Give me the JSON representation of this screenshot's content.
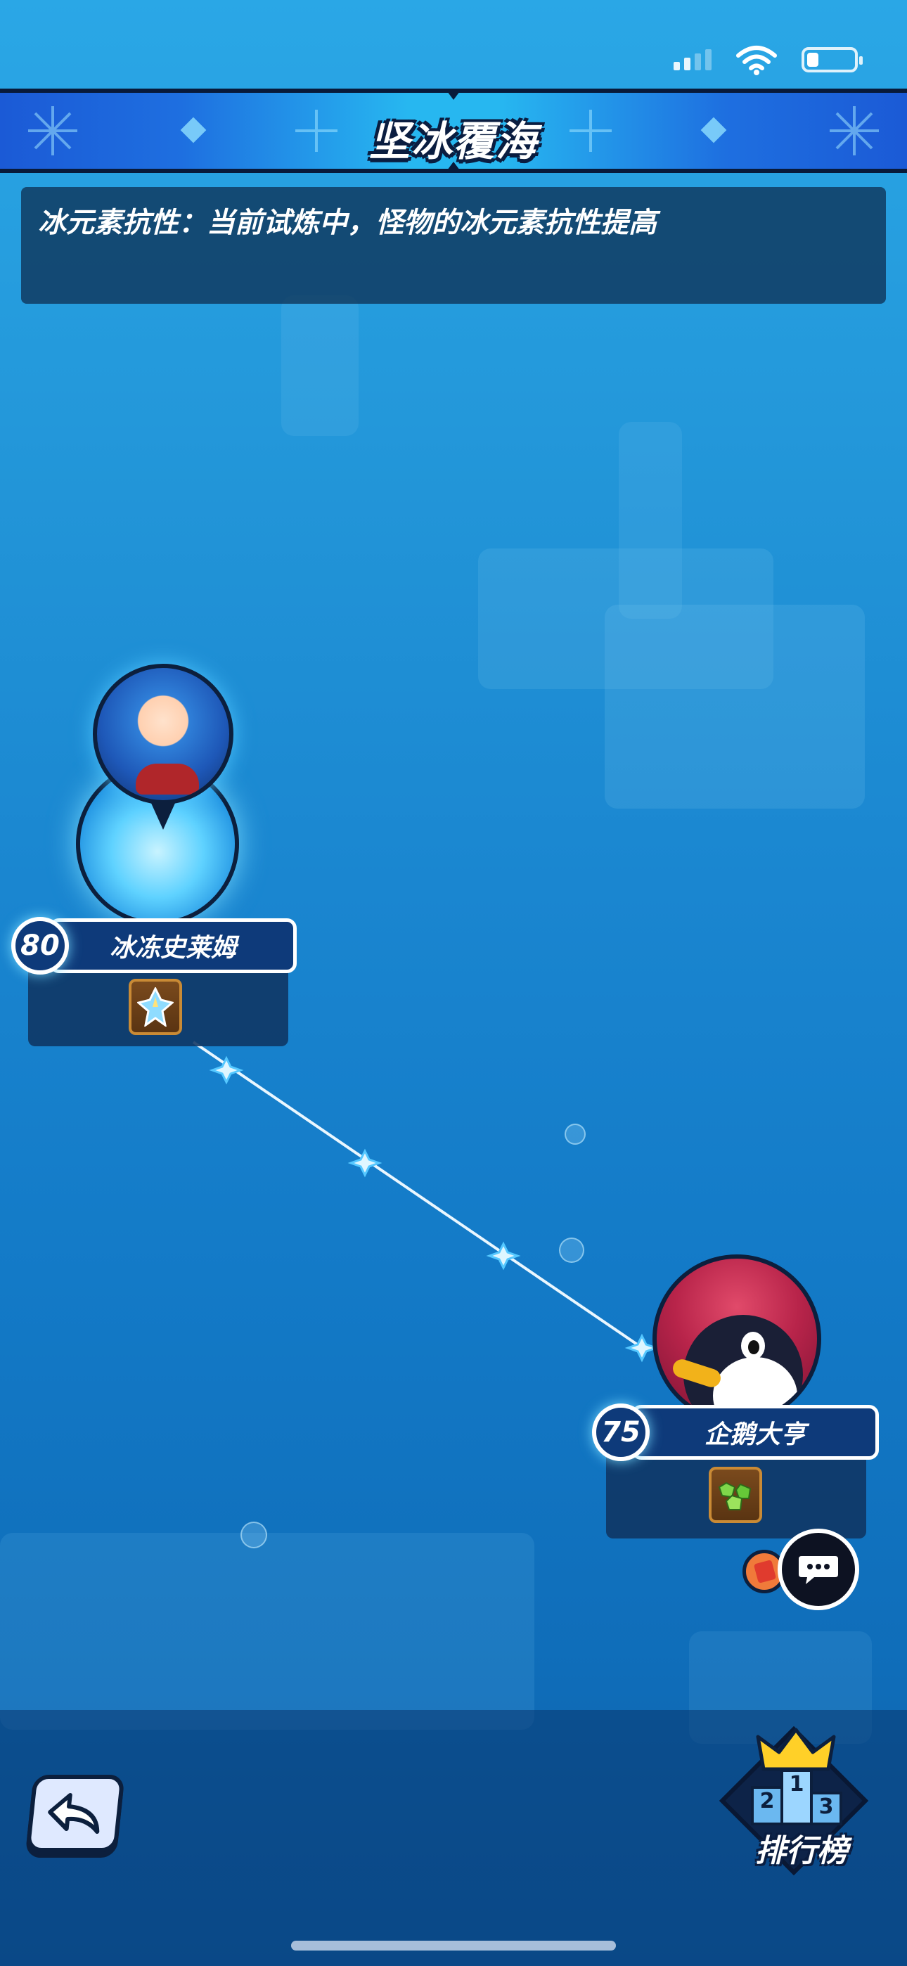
{
  "stage": {
    "title": "坚冰覆海",
    "effect_text": "冰元素抗性：当前试炼中，怪物的冰元素抗性提高"
  },
  "nodes": [
    {
      "level": "80",
      "name": "冰冻史莱姆",
      "reward_icon": "blue-crystal-icon",
      "avatar": "blue-haired-hero-avatar"
    },
    {
      "level": "75",
      "name": "企鹅大亨",
      "reward_icon": "green-gems-icon",
      "avatar": "penguin-boss-avatar"
    }
  ],
  "buttons": {
    "chat_icon": "chat-bubble-icon",
    "back_icon": "back-arrow-icon",
    "leaderboard_label": "排行榜"
  },
  "leaderboard_podium": [
    "1",
    "2",
    "3"
  ],
  "colors": {
    "sky_top": "#2aa7e6",
    "banner_center": "#27b7f0",
    "card_bg": "#0f3462",
    "accent_glow": "#78dcff"
  }
}
